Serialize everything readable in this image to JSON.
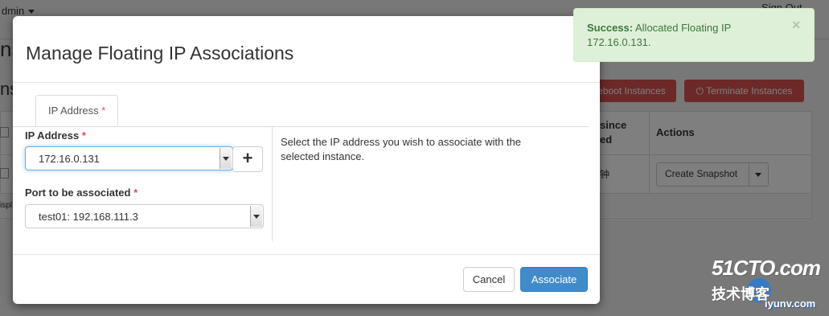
{
  "background": {
    "user_menu": "dmin",
    "sign_out": "Sign Out",
    "heading_partial": "ns",
    "subheading_partial": "ns",
    "reboot_button": "eboot Instances",
    "terminate_button": "Terminate Instances",
    "table": {
      "col_since": "since\ned",
      "col_actions": "Actions",
      "row_cell": "钟",
      "create_snapshot": "Create Snapshot",
      "footer_partial": "ispl"
    }
  },
  "modal": {
    "title": "Manage Floating IP Associations",
    "tab_label": "IP Address",
    "required_mark": "*",
    "ip_address": {
      "label": "IP Address",
      "value": "172.16.0.131",
      "add_button": "+"
    },
    "port": {
      "label": "Port to be associated",
      "value": "test01: 192.168.111.3"
    },
    "help_text": "Select the IP address you wish to associate with the selected instance.",
    "cancel_label": "Cancel",
    "associate_label": "Associate"
  },
  "toast": {
    "title": "Success:",
    "message": "Allocated Floating IP 172.16.0.131.",
    "close": "×"
  },
  "watermark": {
    "brand": "51CTO.com",
    "tagline": "技术博客",
    "url": "iyunv.com"
  },
  "colors": {
    "primary": "#428bca",
    "success_bg": "#dff0d8",
    "success_text": "#3c763d",
    "danger": "#d9534f",
    "required": "#d9534f"
  }
}
